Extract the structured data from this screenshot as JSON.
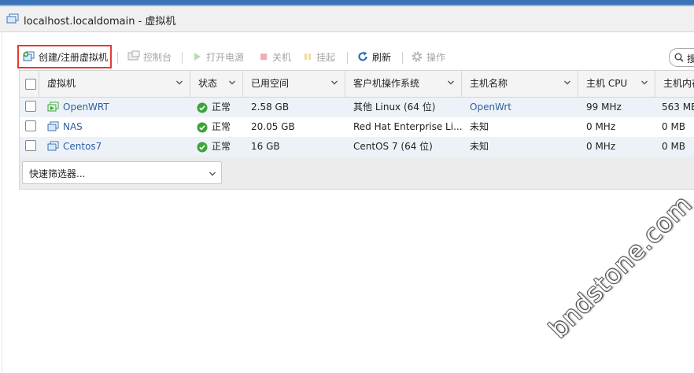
{
  "window": {
    "title": "localhost.localdomain - 虚拟机"
  },
  "toolbar": {
    "create": "创建/注册虚拟机",
    "console": "控制台",
    "power_on": "打开电源",
    "power_off": "关机",
    "suspend": "挂起",
    "refresh": "刷新",
    "actions": "操作"
  },
  "search": {
    "label": "搜"
  },
  "table": {
    "columns": [
      "虚拟机",
      "状态",
      "已用空间",
      "客户机操作系统",
      "主机名称",
      "主机 CPU",
      "主机内存"
    ],
    "rows": [
      {
        "name": "OpenWRT",
        "status": "正常",
        "used": "2.58 GB",
        "os": "其他 Linux (64 位)",
        "host": "OpenWrt",
        "cpu": "99 MHz",
        "mem": "563 MB",
        "powered_on": true
      },
      {
        "name": "NAS",
        "status": "正常",
        "used": "20.05 GB",
        "os": "Red Hat Enterprise Li...",
        "host": "未知",
        "cpu": "0 MHz",
        "mem": "0 MB",
        "powered_on": false
      },
      {
        "name": "Centos7",
        "status": "正常",
        "used": "16 GB",
        "os": "CentOS 7 (64 位)",
        "host": "未知",
        "cpu": "0 MHz",
        "mem": "0 MB",
        "powered_on": false
      }
    ]
  },
  "quick_filter": {
    "placeholder": "快速筛选器..."
  },
  "watermark": "bndstone.com",
  "colors": {
    "accent": "#2f5e9e",
    "highlight": "#e53935",
    "ok": "#3aa53a",
    "row_alt": "#edf2f8"
  }
}
